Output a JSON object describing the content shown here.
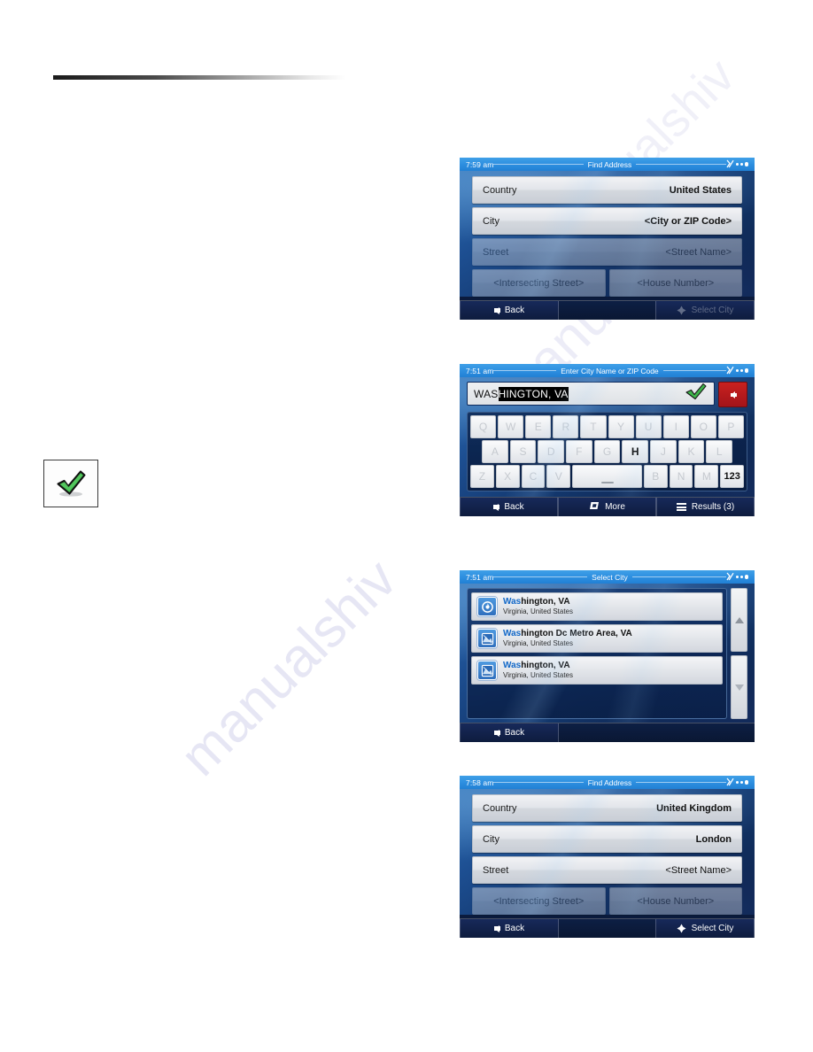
{
  "watermarks": {
    "w1": "manualshiv",
    "w2": "manualshiv",
    "w3": "manualshiv"
  },
  "note_icon": {
    "name": "green-check-tip-icon",
    "color": "#2eaa3c"
  },
  "screens": [
    {
      "id": "find-address-us",
      "time": "7:59 am",
      "title": "Find Address",
      "fields": [
        {
          "label": "Country",
          "value": "United States",
          "bold": true,
          "dim": false
        },
        {
          "label": "City",
          "value": "<City or ZIP Code>",
          "bold": true,
          "dim": false
        },
        {
          "label": "Street",
          "value": "<Street Name>",
          "bold": false,
          "dim": true
        }
      ],
      "pair": [
        {
          "value": "<Intersecting Street>",
          "dim": true
        },
        {
          "value": "<House Number>",
          "dim": true
        }
      ],
      "buttons": {
        "back": "Back",
        "select_city": "Select City",
        "select_city_disabled": true
      }
    },
    {
      "id": "enter-city-name",
      "time": "7:51 am",
      "title": "Enter City Name or ZIP Code",
      "input": {
        "typed": "WAS",
        "selected": "HINGTON, VA"
      },
      "keyboard": {
        "row1": [
          "Q",
          "W",
          "E",
          "R",
          "T",
          "Y",
          "U",
          "I",
          "O",
          "P"
        ],
        "row2": [
          "A",
          "S",
          "D",
          "F",
          "G",
          "H",
          "J",
          "K",
          "L"
        ],
        "row3": [
          "Z",
          "X",
          "C",
          "V",
          "SPACE",
          "B",
          "N",
          "M",
          "123"
        ],
        "active_keys": [
          "H",
          "123"
        ],
        "numeric_label": "123"
      },
      "buttons": {
        "back": "Back",
        "more": "More",
        "results": "Results (3)"
      }
    },
    {
      "id": "select-city",
      "time": "7:51 am",
      "title": "Select City",
      "results": [
        {
          "match": "Was",
          "rest": "hington, VA",
          "subtitle": "Virginia, United States",
          "icon": "city-center-icon"
        },
        {
          "match": "Was",
          "rest": "hington Dc Metro Area, VA",
          "subtitle": "Virginia, United States",
          "icon": "map-area-icon"
        },
        {
          "match": "Was",
          "rest": "hington, VA",
          "subtitle": "Virginia, United States",
          "icon": "map-area-icon"
        }
      ],
      "buttons": {
        "back": "Back"
      }
    },
    {
      "id": "find-address-uk",
      "time": "7:58 am",
      "title": "Find Address",
      "fields": [
        {
          "label": "Country",
          "value": "United Kingdom",
          "bold": true,
          "dim": false
        },
        {
          "label": "City",
          "value": "London",
          "bold": true,
          "dim": false
        },
        {
          "label": "Street",
          "value": "<Street Name>",
          "bold": false,
          "dim": false
        }
      ],
      "pair": [
        {
          "value": "<Intersecting Street>",
          "dim": true
        },
        {
          "value": "<House Number>",
          "dim": true
        }
      ],
      "buttons": {
        "back": "Back",
        "select_city": "Select City",
        "select_city_disabled": false
      }
    }
  ]
}
